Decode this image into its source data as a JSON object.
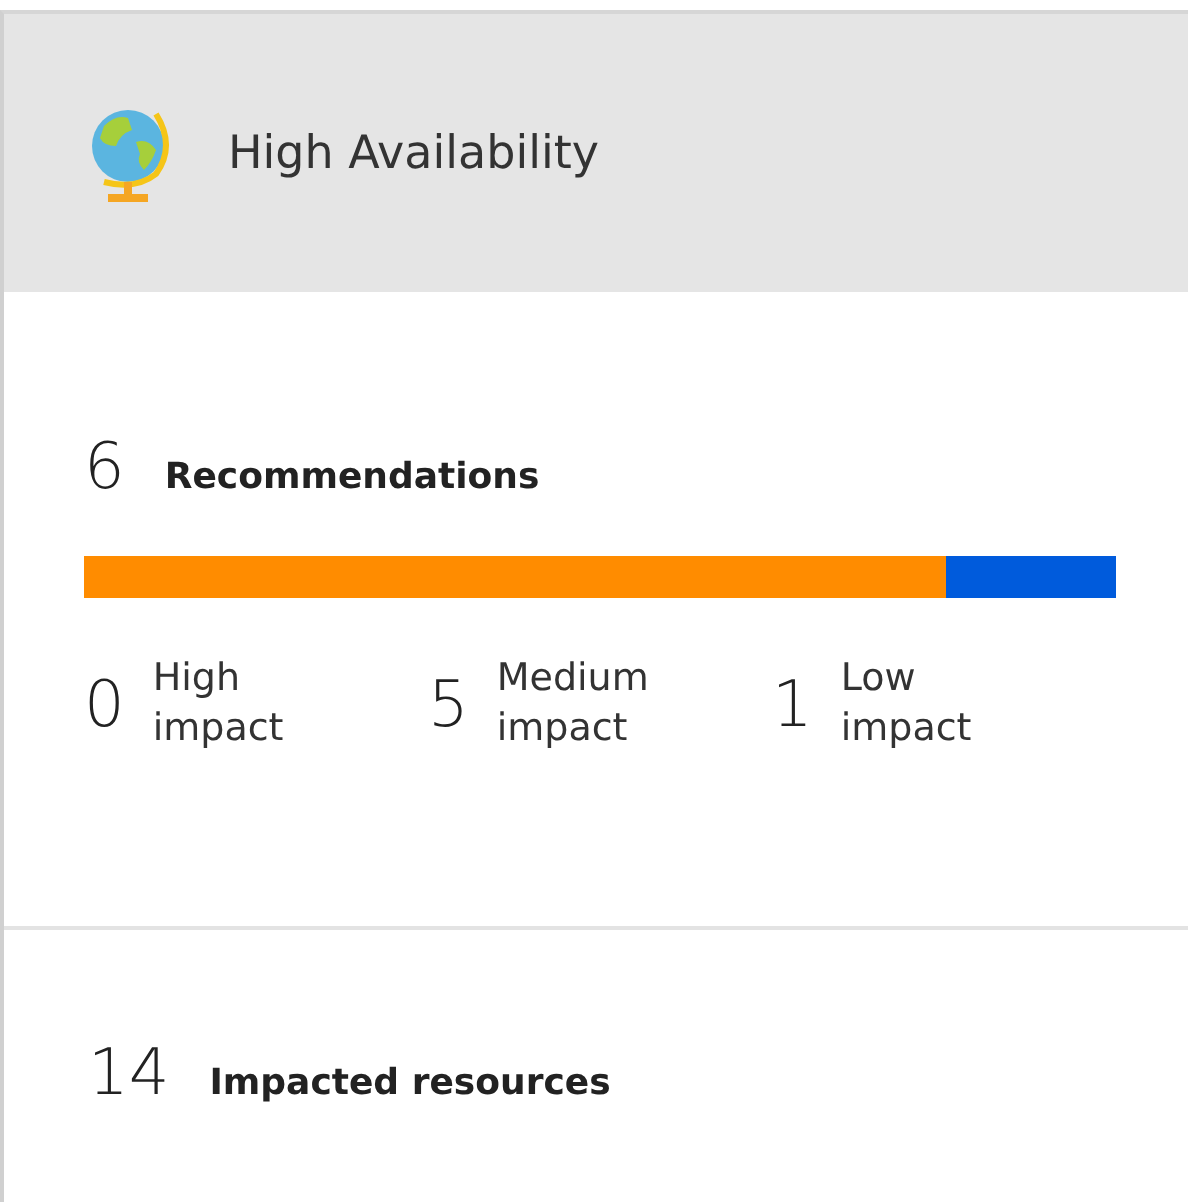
{
  "header": {
    "title": "High Availability"
  },
  "recommendations": {
    "count": "6",
    "label": "Recommendations",
    "impact_bar": {
      "level": 0.835
    },
    "impacts": [
      {
        "count": "0",
        "label_line1": "High",
        "label_line2": "impact"
      },
      {
        "count": "5",
        "label_line1": "Medium",
        "label_line2": "impact"
      },
      {
        "count": "1",
        "label_line1": "Low",
        "label_line2": "impact"
      }
    ]
  },
  "resources": {
    "count": "14",
    "label": "Impacted resources"
  }
}
